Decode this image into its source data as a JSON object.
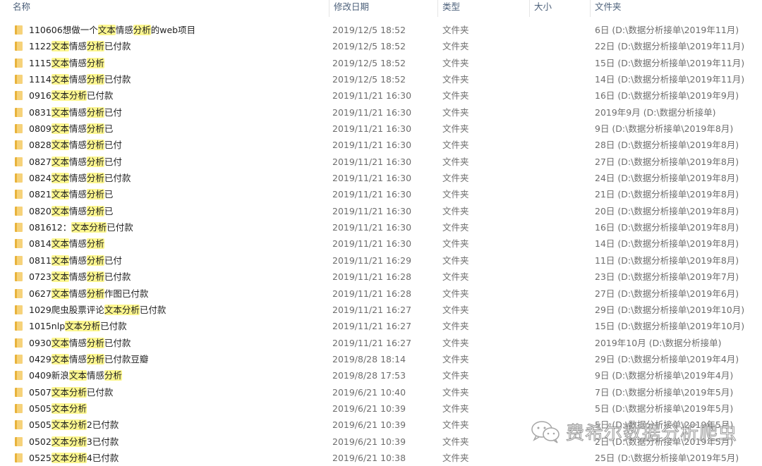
{
  "columns": {
    "name": "名称",
    "date": "修改日期",
    "type": "类型",
    "size": "大小",
    "folder": "文件夹"
  },
  "highlight_color": "#fcf68f",
  "folder_icon_color": "#f6d27a",
  "rows": [
    {
      "name": [
        [
          "110606想做一个",
          0
        ],
        [
          "文本",
          1
        ],
        [
          "情感",
          0
        ],
        [
          "分析",
          1
        ],
        [
          "的web项目",
          0
        ]
      ],
      "date": "2019/12/5 18:52",
      "type": "文件夹",
      "size": "",
      "folder": "6日 (D:\\数据分析接单\\2019年11月)"
    },
    {
      "name": [
        [
          "1122",
          0
        ],
        [
          "文本",
          1
        ],
        [
          "情感",
          0
        ],
        [
          "分析",
          1
        ],
        [
          "已付款",
          0
        ]
      ],
      "date": "2019/12/5 18:52",
      "type": "文件夹",
      "size": "",
      "folder": "22日 (D:\\数据分析接单\\2019年11月)"
    },
    {
      "name": [
        [
          "1115",
          0
        ],
        [
          "文本",
          1
        ],
        [
          "情感",
          0
        ],
        [
          "分析",
          1
        ]
      ],
      "date": "2019/12/5 18:52",
      "type": "文件夹",
      "size": "",
      "folder": "15日 (D:\\数据分析接单\\2019年11月)"
    },
    {
      "name": [
        [
          "1114",
          0
        ],
        [
          "文本",
          1
        ],
        [
          "情感",
          0
        ],
        [
          "分析",
          1
        ],
        [
          "已付款",
          0
        ]
      ],
      "date": "2019/12/5 18:52",
      "type": "文件夹",
      "size": "",
      "folder": "14日 (D:\\数据分析接单\\2019年11月)"
    },
    {
      "name": [
        [
          "0916",
          0
        ],
        [
          "文本分析",
          1
        ],
        [
          "已付款",
          0
        ]
      ],
      "date": "2019/11/21 16:30",
      "type": "文件夹",
      "size": "",
      "folder": "16日 (D:\\数据分析接单\\2019年9月)"
    },
    {
      "name": [
        [
          "0831",
          0
        ],
        [
          "文本",
          1
        ],
        [
          "情感",
          0
        ],
        [
          "分析",
          1
        ],
        [
          "已付",
          0
        ]
      ],
      "date": "2019/11/21 16:30",
      "type": "文件夹",
      "size": "",
      "folder": "2019年9月 (D:\\数据分析接单)"
    },
    {
      "name": [
        [
          "0809",
          0
        ],
        [
          "文本",
          1
        ],
        [
          "情感",
          0
        ],
        [
          "分析",
          1
        ],
        [
          "已",
          0
        ]
      ],
      "date": "2019/11/21 16:30",
      "type": "文件夹",
      "size": "",
      "folder": "9日 (D:\\数据分析接单\\2019年8月)"
    },
    {
      "name": [
        [
          "0828",
          0
        ],
        [
          "文本",
          1
        ],
        [
          "情感",
          0
        ],
        [
          "分析",
          1
        ],
        [
          "已付",
          0
        ]
      ],
      "date": "2019/11/21 16:30",
      "type": "文件夹",
      "size": "",
      "folder": "28日 (D:\\数据分析接单\\2019年8月)"
    },
    {
      "name": [
        [
          "0827",
          0
        ],
        [
          "文本",
          1
        ],
        [
          "情感",
          0
        ],
        [
          "分析",
          1
        ],
        [
          "已付",
          0
        ]
      ],
      "date": "2019/11/21 16:30",
      "type": "文件夹",
      "size": "",
      "folder": "27日 (D:\\数据分析接单\\2019年8月)"
    },
    {
      "name": [
        [
          "0824",
          0
        ],
        [
          "文本",
          1
        ],
        [
          "情感",
          0
        ],
        [
          "分析",
          1
        ],
        [
          "已付款",
          0
        ]
      ],
      "date": "2019/11/21 16:30",
      "type": "文件夹",
      "size": "",
      "folder": "24日 (D:\\数据分析接单\\2019年8月)"
    },
    {
      "name": [
        [
          "0821",
          0
        ],
        [
          "文本",
          1
        ],
        [
          "情感",
          0
        ],
        [
          "分析",
          1
        ],
        [
          "已",
          0
        ]
      ],
      "date": "2019/11/21 16:30",
      "type": "文件夹",
      "size": "",
      "folder": "21日 (D:\\数据分析接单\\2019年8月)"
    },
    {
      "name": [
        [
          "0820",
          0
        ],
        [
          "文本",
          1
        ],
        [
          "情感",
          0
        ],
        [
          "分析",
          1
        ],
        [
          "已",
          0
        ]
      ],
      "date": "2019/11/21 16:30",
      "type": "文件夹",
      "size": "",
      "folder": "20日 (D:\\数据分析接单\\2019年8月)"
    },
    {
      "name": [
        [
          "081612：",
          0
        ],
        [
          "文本分析",
          1
        ],
        [
          "已付款",
          0
        ]
      ],
      "date": "2019/11/21 16:30",
      "type": "文件夹",
      "size": "",
      "folder": "16日 (D:\\数据分析接单\\2019年8月)"
    },
    {
      "name": [
        [
          "0814",
          0
        ],
        [
          "文本",
          1
        ],
        [
          "情感",
          0
        ],
        [
          "分析",
          1
        ]
      ],
      "date": "2019/11/21 16:30",
      "type": "文件夹",
      "size": "",
      "folder": "14日 (D:\\数据分析接单\\2019年8月)"
    },
    {
      "name": [
        [
          "0811",
          0
        ],
        [
          "文本",
          1
        ],
        [
          "情感",
          0
        ],
        [
          "分析",
          1
        ],
        [
          "已付",
          0
        ]
      ],
      "date": "2019/11/21 16:29",
      "type": "文件夹",
      "size": "",
      "folder": "11日 (D:\\数据分析接单\\2019年8月)"
    },
    {
      "name": [
        [
          "0723",
          0
        ],
        [
          "文本",
          1
        ],
        [
          "情感",
          0
        ],
        [
          "分析",
          1
        ],
        [
          "已付款",
          0
        ]
      ],
      "date": "2019/11/21 16:28",
      "type": "文件夹",
      "size": "",
      "folder": "23日 (D:\\数据分析接单\\2019年7月)"
    },
    {
      "name": [
        [
          "0627",
          0
        ],
        [
          "文本",
          1
        ],
        [
          "情感",
          0
        ],
        [
          "分析",
          1
        ],
        [
          "作图已付款",
          0
        ]
      ],
      "date": "2019/11/21 16:28",
      "type": "文件夹",
      "size": "",
      "folder": "27日 (D:\\数据分析接单\\2019年6月)"
    },
    {
      "name": [
        [
          "1029爬虫股票评论",
          0
        ],
        [
          "文本分析",
          1
        ],
        [
          "已付款",
          0
        ]
      ],
      "date": "2019/11/21 16:27",
      "type": "文件夹",
      "size": "",
      "folder": "29日 (D:\\数据分析接单\\2019年10月)"
    },
    {
      "name": [
        [
          "1015nlp",
          0
        ],
        [
          "文本分析",
          1
        ],
        [
          "已付款",
          0
        ]
      ],
      "date": "2019/11/21 16:27",
      "type": "文件夹",
      "size": "",
      "folder": "15日 (D:\\数据分析接单\\2019年10月)"
    },
    {
      "name": [
        [
          "0930",
          0
        ],
        [
          "文本",
          1
        ],
        [
          "情感",
          0
        ],
        [
          "分析",
          1
        ],
        [
          "已付款",
          0
        ]
      ],
      "date": "2019/11/21 16:27",
      "type": "文件夹",
      "size": "",
      "folder": "2019年10月 (D:\\数据分析接单)"
    },
    {
      "name": [
        [
          "0429",
          0
        ],
        [
          "文本",
          1
        ],
        [
          "情感",
          0
        ],
        [
          "分析",
          1
        ],
        [
          "已付款豆瓣",
          0
        ]
      ],
      "date": "2019/8/28 18:14",
      "type": "文件夹",
      "size": "",
      "folder": "29日 (D:\\数据分析接单\\2019年4月)"
    },
    {
      "name": [
        [
          "0409新浪",
          0
        ],
        [
          "文本",
          1
        ],
        [
          "情感",
          0
        ],
        [
          "分析",
          1
        ]
      ],
      "date": "2019/8/28 17:53",
      "type": "文件夹",
      "size": "",
      "folder": "9日 (D:\\数据分析接单\\2019年4月)"
    },
    {
      "name": [
        [
          "0507",
          0
        ],
        [
          "文本分析",
          1
        ],
        [
          "已付款",
          0
        ]
      ],
      "date": "2019/6/21 10:40",
      "type": "文件夹",
      "size": "",
      "folder": "7日 (D:\\数据分析接单\\2019年5月)"
    },
    {
      "name": [
        [
          "0505",
          0
        ],
        [
          "文本分析",
          1
        ]
      ],
      "date": "2019/6/21 10:39",
      "type": "文件夹",
      "size": "",
      "folder": "5日 (D:\\数据分析接单\\2019年5月)"
    },
    {
      "name": [
        [
          "0505",
          0
        ],
        [
          "文本分析",
          1
        ],
        [
          "2已付款",
          0
        ]
      ],
      "date": "2019/6/21 10:39",
      "type": "文件夹",
      "size": "",
      "folder": "5日 (D:\\数据分析接单\\2019年5月)"
    },
    {
      "name": [
        [
          "0502",
          0
        ],
        [
          "文本分析",
          1
        ],
        [
          "3已付款",
          0
        ]
      ],
      "date": "2019/6/21 10:39",
      "type": "文件夹",
      "size": "",
      "folder": "2日 (D:\\数据分析接单\\2019年5月)"
    },
    {
      "name": [
        [
          "0525",
          0
        ],
        [
          "文本分析",
          1
        ],
        [
          "4已付款",
          0
        ]
      ],
      "date": "2019/6/21 10:38",
      "type": "文件夹",
      "size": "",
      "folder": "25日 (D:\\数据分析接单\\2019年5月)"
    }
  ],
  "watermark": {
    "icon": "wechat-icon",
    "text": "费希尔数据分析爬虫"
  }
}
